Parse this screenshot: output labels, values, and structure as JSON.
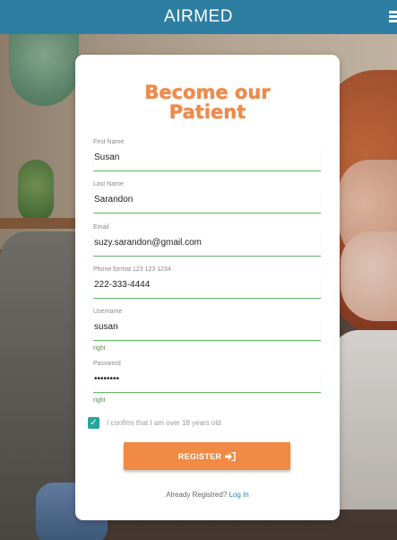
{
  "header": {
    "brand": "AIRMED",
    "menu_icon": "hamburger-menu-icon"
  },
  "form": {
    "title_line1": "Become our",
    "title_line2": "Patient",
    "first_name": {
      "label": "First Name",
      "value": "Susan"
    },
    "last_name": {
      "label": "Last Name",
      "value": "Sarandon"
    },
    "email": {
      "label": "Email",
      "value": "suzy.sarandon@gmail.com"
    },
    "phone": {
      "label": "Phone format 123 123 1234",
      "value": "222-333-4444"
    },
    "username": {
      "label": "Username",
      "value": "susan",
      "hint": "right"
    },
    "password": {
      "label": "Password",
      "value": "••••••••",
      "hint": "right"
    },
    "confirm": {
      "checked": true,
      "text": "I confirm that I am over 18 years old"
    },
    "register_label": "REGISTER",
    "already_text": "Already Registred?",
    "login_link": "Log In"
  },
  "colors": {
    "header": "#2e7ea4",
    "accent": "#f08a45",
    "underline": "#66bb6a",
    "checkbox": "#26a69a"
  }
}
